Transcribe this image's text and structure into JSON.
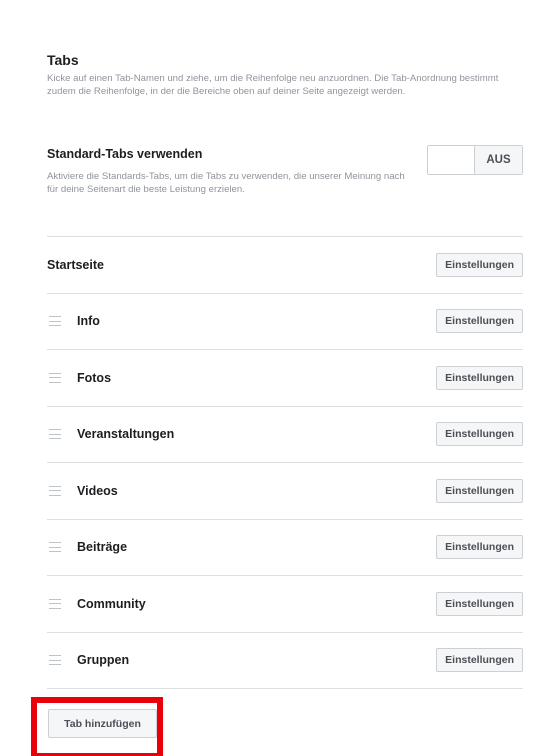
{
  "tabs_section": {
    "title": "Tabs",
    "description": "Kicke auf einen Tab-Namen und ziehe, um die Reihenfolge neu anzuordnen. Die Tab-Anordnung bestimmt zudem die Reihenfolge, in der die Bereiche oben auf deiner Seite angezeigt werden."
  },
  "standard_tabs": {
    "title": "Standard-Tabs verwenden",
    "description": "Aktiviere die Standards-Tabs, um die Tabs zu verwenden, die unserer Meinung nach für deine Seitenart die beste Leistung erzielen.",
    "toggle_label": "AUS"
  },
  "tab_items": [
    {
      "name": "Startseite",
      "settings_label": "Einstellungen"
    },
    {
      "name": "Info",
      "settings_label": "Einstellungen"
    },
    {
      "name": "Fotos",
      "settings_label": "Einstellungen"
    },
    {
      "name": "Veranstaltungen",
      "settings_label": "Einstellungen"
    },
    {
      "name": "Videos",
      "settings_label": "Einstellungen"
    },
    {
      "name": "Beiträge",
      "settings_label": "Einstellungen"
    },
    {
      "name": "Community",
      "settings_label": "Einstellungen"
    },
    {
      "name": "Gruppen",
      "settings_label": "Einstellungen"
    }
  ],
  "add_tab_label": "Tab hinzufügen",
  "colors": {
    "highlight": "#e8000b"
  }
}
